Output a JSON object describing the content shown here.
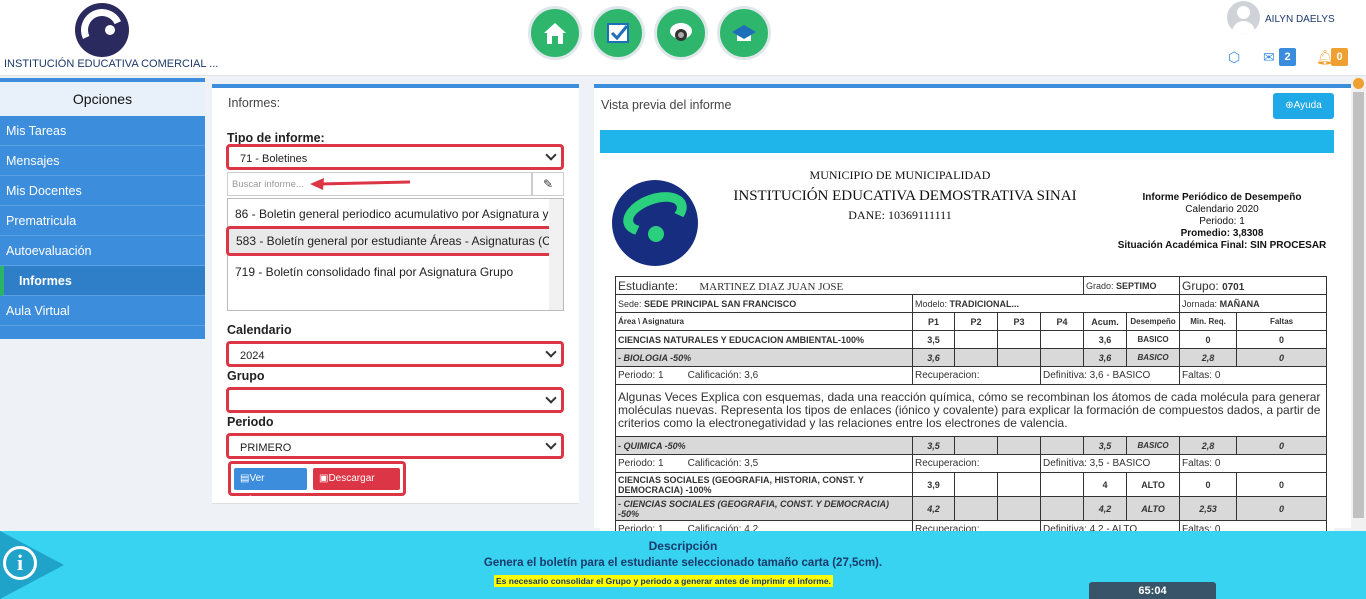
{
  "header": {
    "institution_name": "INSTITUCIÓN EDUCATIVA COMERCIAL ...",
    "user_name": "AILYN DAELYS",
    "messages_count": "2",
    "notifications_count": "0",
    "nav_icons": [
      "home-icon",
      "task-check-icon",
      "camera-icon",
      "graduation-cap-icon"
    ]
  },
  "sidebar": {
    "title": "Opciones",
    "items": [
      {
        "label": "Mis Tareas"
      },
      {
        "label": "Mensajes"
      },
      {
        "label": "Mis Docentes"
      },
      {
        "label": "Prematricula"
      },
      {
        "label": "Autoevaluación"
      },
      {
        "label": "Informes"
      },
      {
        "label": "Aula Virtual"
      }
    ]
  },
  "form": {
    "panel_title": "Informes:",
    "tipo_label": "Tipo de informe:",
    "tipo_value": "71 - Boletines",
    "search_placeholder": "Buscar informe...",
    "report_list": [
      "86 - Boletin general periodico acumulativo por Asignatura y",
      "583 - Boletín general por estudiante Áreas - Asignaturas (C",
      "719 - Boletín consolidado final por Asignatura Grupo"
    ],
    "calendario_label": "Calendario",
    "calendario_value": "2024",
    "grupo_label": "Grupo",
    "grupo_value": "",
    "periodo_label": "Periodo",
    "periodo_value": "PRIMERO",
    "ver_informe": "Ver Informe",
    "descargar_pdf": "Descargar PDF"
  },
  "preview": {
    "title": "Vista previa del informe",
    "help_label": "Ayuda",
    "doc": {
      "municipio": "MUNICIPIO DE MUNICIPALIDAD",
      "institucion": "INSTITUCIÓN EDUCATIVA DEMOSTRATIVA SINAI",
      "dane": "DANE: 10369111111",
      "report_title": "Informe Periódico de Desempeño",
      "calendario": "Calendario 2020",
      "periodo": "Periodo: 1",
      "promedio": "Promedio: 3,8308",
      "situacion": "Situación Académica Final: SIN PROCESAR",
      "estudiante_label": "Estudiante:",
      "estudiante": "MARTINEZ DIAZ JUAN JOSE",
      "grado_label": "Grado:",
      "grado": "SEPTIMO",
      "grupo_label": "Grupo:",
      "grupo": "0701",
      "sede_label": "Sede:",
      "sede": "SEDE PRINCIPAL SAN FRANCISCO",
      "modelo_label": "Modelo:",
      "modelo": "TRADICIONAL...",
      "jornada_label": "Jornada:",
      "jornada": "MAÑANA",
      "headers": [
        "Área \\ Asignatura",
        "P1",
        "P2",
        "P3",
        "P4",
        "Acum.",
        "Desempeño",
        "Min. Req.",
        "Faltas"
      ],
      "area1": {
        "name": "CIENCIAS NATURALES Y EDUCACION AMBIENTAL-100%",
        "p1": "3,5",
        "acum": "3,6",
        "desemp": "BASICO",
        "min": "0",
        "faltas": "0"
      },
      "asig1": {
        "name": "-  BIOLOGIA -50%",
        "p1": "3,6",
        "acum": "3,6",
        "desemp": "BASICO",
        "min": "2,8",
        "faltas": "0"
      },
      "det1": {
        "periodo": "Periodo: 1",
        "calif": "Calificación: 3,6",
        "recup": "Recuperacion:",
        "def": "Definitiva: 3,6 - BASICO",
        "faltas": "Faltas: 0"
      },
      "descripcion": "Algunas Veces Explica con esquemas, dada una reacción química, cómo se recombinan los átomos de cada molécula para generar moléculas nuevas.   Representa los tipos de enlaces (iónico y covalente) para explicar la formación de compuestos dados, a partir de criterios como la electronegatividad y las relaciones entre los electrones de valencia.",
      "asig2": {
        "name": "-  QUIMICA -50%",
        "p1": "3,5",
        "acum": "3,5",
        "desemp": "BASICO",
        "min": "2,8",
        "faltas": "0"
      },
      "det2": {
        "periodo": "Periodo: 1",
        "calif": "Calificación: 3,5",
        "recup": "Recuperacion:",
        "def": "Definitiva: 3,5 - BASICO",
        "faltas": "Faltas: 0"
      },
      "area2": {
        "name": "CIENCIAS SOCIALES (GEOGRAFIA, HISTORIA, CONST. Y DEMOCRACIA) -100%",
        "p1": "3,9",
        "acum": "4",
        "desemp": "ALTO",
        "min": "0",
        "faltas": "0"
      },
      "asig3": {
        "name": "-  CIENCIAS SOCIALES (GEOGRAFIA, CONST. Y DEMOCRACIA) -50%",
        "p1": "4,2",
        "acum": "4,2",
        "desemp": "ALTO",
        "min": "2,53",
        "faltas": "0"
      },
      "det3": {
        "periodo": "Periodo: 1",
        "calif": "Calificación: 4,2",
        "recup": "Recuperacion:",
        "def": "Definitiva: 4,2 - ALTO",
        "faltas": "Faltas: 0"
      }
    }
  },
  "footer": {
    "title": "Descripción",
    "description": "Genera el boletín para el estudiante seleccionado tamaño carta (27,5cm).",
    "note": "Es necesario consolidar el Grupo y periodo a generar antes de imprimir el informe.",
    "timer": "65:04"
  }
}
